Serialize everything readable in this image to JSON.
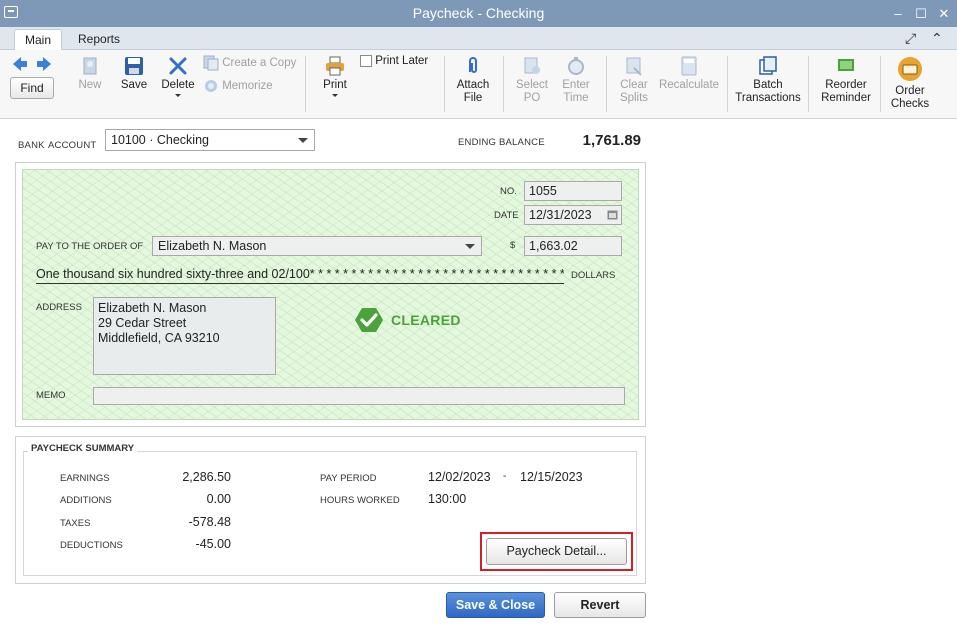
{
  "window": {
    "title": "Paycheck - Checking"
  },
  "tabs": [
    {
      "label": "Main"
    },
    {
      "label": "Reports"
    }
  ],
  "toolbar": {
    "find": "Find",
    "new": "New",
    "save": "Save",
    "delete": "Delete",
    "create_copy": "Create a Copy",
    "memorize": "Memorize",
    "print": "Print",
    "print_later": "Print Later",
    "attach_file_1": "Attach",
    "attach_file_2": "File",
    "select_po_1": "Select",
    "select_po_2": "PO",
    "enter_time_1": "Enter",
    "enter_time_2": "Time",
    "clear_splits_1": "Clear",
    "clear_splits_2": "Splits",
    "recalculate": "Recalculate",
    "batch_1": "Batch",
    "batch_2": "Transactions",
    "reorder_1": "Reorder",
    "reorder_2": "Reminder",
    "order_checks_1": "Order",
    "order_checks_2": "Checks"
  },
  "bank": {
    "label_bank": "BANK",
    "label_account": "ACCOUNT",
    "account": "10100 · Checking",
    "ending_balance_label": "ENDING BALANCE",
    "ending_balance": "1,761.89"
  },
  "check": {
    "no_label": "NO.",
    "no": "1055",
    "date_label": "DATE",
    "date": "12/31/2023",
    "payto_label": "PAY TO THE ORDER OF",
    "payee": "Elizabeth N. Mason",
    "currency_symbol": "$",
    "amount": "1,663.02",
    "amount_words": "One thousand six hundred sixty-three and 02/100* * * * * * * * * * * * * * * * * * * * * * * * * * * * * * * * * *",
    "dollars_label": "DOLLARS",
    "address_label": "ADDRESS",
    "address_lines": [
      "Elizabeth N. Mason",
      "29 Cedar Street",
      "Middlefield, CA 93210"
    ],
    "status": "CLEARED",
    "memo_label": "MEMO",
    "memo": ""
  },
  "summary": {
    "title": "PAYCHECK SUMMARY",
    "earnings_label": "EARNINGS",
    "earnings": "2,286.50",
    "additions_label": "ADDITIONS",
    "additions": "0.00",
    "taxes_label": "TAXES",
    "taxes": "-578.48",
    "deductions_label": "DEDUCTIONS",
    "deductions": "-45.00",
    "pay_period_label": "PAY PERIOD",
    "pay_period_start": "12/02/2023",
    "pay_period_sep": "-",
    "pay_period_end": "12/15/2023",
    "hours_label": "HOURS WORKED",
    "hours": "130:00",
    "detail_button": "Paycheck Detail..."
  },
  "footer": {
    "save_close": "Save & Close",
    "revert": "Revert"
  },
  "colors": {
    "titlebar": "#7e99b8",
    "cleared": "#4aa23a",
    "primary_button": "#2d68c4",
    "highlight": "#d0202a"
  }
}
